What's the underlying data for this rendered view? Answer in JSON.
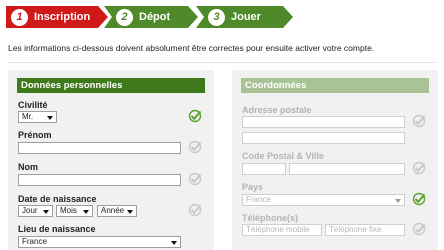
{
  "steps": [
    {
      "number": "1",
      "label": "Inscription",
      "state": "active"
    },
    {
      "number": "2",
      "label": "Dépot",
      "state": "inactive"
    },
    {
      "number": "3",
      "label": "Jouer",
      "state": "inactive"
    }
  ],
  "intro_text": "Les informations ci-dessous doivent absolument être correctes pour ensuite activer votre compte.",
  "personal": {
    "title": "Données personnelles",
    "civilite_label": "Civilité",
    "civilite_value": "Mr.",
    "prenom_label": "Prénom",
    "nom_label": "Nom",
    "dob_label": "Date de naissance",
    "dob_day": "Jour",
    "dob_month": "Mois",
    "dob_year": "Année",
    "lieu_label": "Lieu de naissance",
    "lieu_value": "France"
  },
  "coords": {
    "title": "Coordonnées",
    "adresse_label": "Adresse postale",
    "cp_ville_label": "Code Postal & Ville",
    "pays_label": "Pays",
    "pays_value": "France",
    "tel_label": "Téléphone(s)",
    "tel_mobile_placeholder": "Téléphone mobile",
    "tel_fixe_placeholder": "Téléphone fixe"
  },
  "colors": {
    "active_step": "#d01a1a",
    "inactive_step": "#4f8a2a",
    "section_header": "#3e7a1c",
    "section_header_disabled": "#a8c396",
    "check_valid": "#5aa02c",
    "check_pending": "#c8c8c8"
  }
}
